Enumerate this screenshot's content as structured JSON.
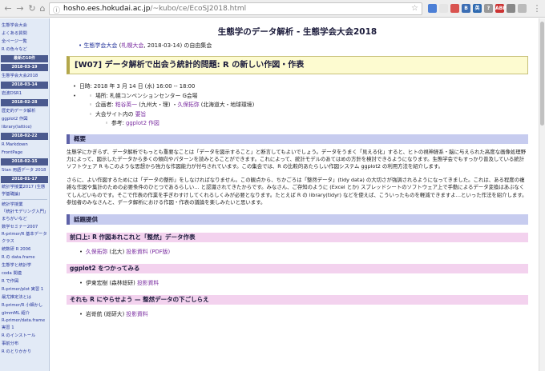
{
  "browser": {
    "url_host": "hosho.ees.hokudai.ac.jp",
    "url_path": "/~kubo/ce/EcoSJ2018.html",
    "ext_labels": [
      "B",
      "英",
      "?",
      "ABP"
    ]
  },
  "sidebar": {
    "top_links": [
      "生態学会大会",
      "よくある質問",
      "全ページ一覧",
      "R の色々など"
    ],
    "recent_label": "最新の10件",
    "groups": [
      {
        "date": "2018-03-19",
        "items": [
          "生態学会大会2018"
        ]
      },
      {
        "date": "2018-03-14",
        "items": [
          "岩波DSR1"
        ]
      },
      {
        "date": "2018-02-28",
        "items": [
          "歴史的データ解析",
          "ggplot2 作図",
          "library(lattice)"
        ]
      },
      {
        "date": "2018-02-22",
        "items": [
          "R Markdown",
          "FrontPage"
        ]
      },
      {
        "date": "2018-02-15",
        "items": [
          "Stan 用語データ 2018"
        ]
      },
      {
        "date": "2018-01-17",
        "items": [
          "統計学授業2017 (生態学基礎論)"
        ]
      }
    ],
    "bottom_links": [
      "統計学授業",
      "「統計モデリング入門」まちがいなど",
      "数学セミナー2007",
      "R-primer/R 基本データクラス",
      "統数研 R 2006",
      "R の data.frame",
      "生態学と統計学",
      "coda 関連",
      "R で作図",
      "R-primer/plot 実習 1",
      "最尤推定法とは",
      "R-primer/R 小細かし",
      "glmmML 紹介",
      "R-primer/data.frame 実習 1",
      "R のインストール",
      "事前分布",
      "R のとりかかり"
    ]
  },
  "page": {
    "title": "生態学のデータ解析 - 生態学会大会2018",
    "crumb_link": "生態学会大会",
    "crumb_paren_link": "札幌大会",
    "crumb_rest": ", 2018-03-14) の自由集会",
    "topic": "[W07] データ解析で出会う統計的問題: R の新しい作図・作表",
    "info": {
      "date": "日時: 2018 年 3 月 14 日 (水) 16:00 -- 18:00",
      "place": "場所: 札幌コンベンションセンター G会場",
      "organizers_prefix": "企画者: ",
      "organizer1": "粕谷英一",
      "organizer1_note": " (九州大・理) ・",
      "organizer2": "久保拓弥",
      "organizer2_note": " (北海道大・地球環境)",
      "site_prefix": "大会サイト内の ",
      "site_link": "要旨",
      "ref_prefix": "参考: ",
      "ref_link": "ggplot2 作図"
    },
    "overview_heading": "概要",
    "overview_p1": "生態学にかぎらず、データ解析でもっとも重要なことは「データを図示すること」と断言してもよいでしょう。データをうまく「見える化」すると、ヒトの視神経系・脳に与えられた高度な画像処理野力によって、図示したデータから多くの傾向やパターンを読みとることができます。これによって、統計モデルのあてはめの方針を検討できるようになります。生態学会でもすっかり普及している統計ソフトウェア R もこのような思想から強力な作図能力が付与されています。この集会では、R の比較的あたらしい作図システム ggplot2 の利用方法を紹介します。",
    "overview_p2": "さらに、よい作図するためには「データの整形」をしなければなりません。この観点から、ちかごろは「整然データ」(tidy data) の大切さが強調されるようになってきました。これは、ある程度の複雑な作図や集計のための必要条件のひとつであるらしい… と認識されてきたからです。みなさん、ご存知のように (Excel とか) スプレッドシートのソフトウェア上で手動によるデータ変換はあぶなくてしんどいものです。そこで作表の作業を手ぎわすけしてくれるしくみが必要となります。たとえば R の library(tidyr) などを使えば、こういったものを軽減できますよ…といった作法を紹介します。参加者のみなさんと、データ解析における作図・作表の議論を楽しみたいと思います。",
    "talks_heading": "話題提供",
    "talks": [
      {
        "title": "前口上: R 作図あれこれと「整然」データ作表",
        "speaker": "久保拓弥",
        "speaker_link": true,
        "note": " (北大) ",
        "material": "投影資料 (PDF版)"
      },
      {
        "title": "ggplot2 をつかってみる",
        "speaker": "伊東宏樹 (森林総研) ",
        "speaker_link": false,
        "note": "",
        "material": "投影資料"
      },
      {
        "title": "それも R にやらせよう — 整然データの下ごしらえ",
        "speaker": "岩嵜航 (総研大) ",
        "speaker_link": false,
        "note": "",
        "material": "投影資料"
      }
    ]
  }
}
